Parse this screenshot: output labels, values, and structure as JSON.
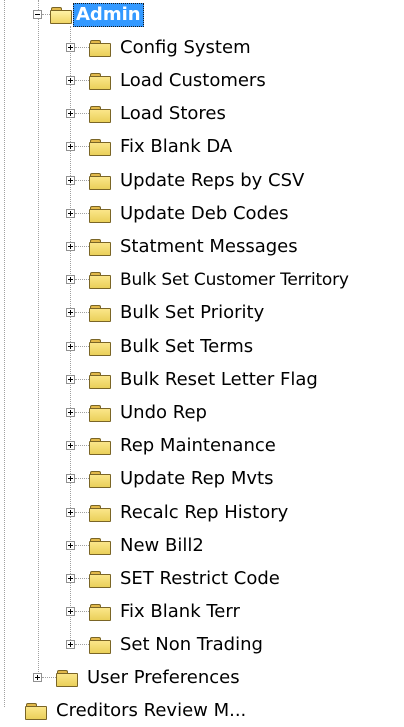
{
  "tree": {
    "root": {
      "label": "Admin",
      "expanded": true,
      "selected": true,
      "icon": "folder-open-icon",
      "children": [
        {
          "label": "Config System",
          "icon": "folder-icon",
          "expander": "plus"
        },
        {
          "label": "Load Customers",
          "icon": "folder-icon",
          "expander": "plus"
        },
        {
          "label": "Load Stores",
          "icon": "folder-icon",
          "expander": "plus"
        },
        {
          "label": "Fix Blank DA",
          "icon": "folder-icon",
          "expander": "plus"
        },
        {
          "label": "Update Reps by CSV",
          "icon": "folder-icon",
          "expander": "plus"
        },
        {
          "label": "Update Deb Codes",
          "icon": "folder-icon",
          "expander": "plus"
        },
        {
          "label": "Statment Messages",
          "icon": "folder-icon",
          "expander": "plus"
        },
        {
          "label": "Bulk Set Customer Territory",
          "icon": "folder-icon",
          "expander": "plus"
        },
        {
          "label": "Bulk Set Priority",
          "icon": "folder-icon",
          "expander": "plus"
        },
        {
          "label": "Bulk Set Terms",
          "icon": "folder-icon",
          "expander": "plus"
        },
        {
          "label": "Bulk Reset Letter Flag",
          "icon": "folder-icon",
          "expander": "plus"
        },
        {
          "label": "Undo Rep",
          "icon": "folder-icon",
          "expander": "plus"
        },
        {
          "label": "Rep Maintenance",
          "icon": "folder-icon",
          "expander": "plus"
        },
        {
          "label": "Update Rep Mvts",
          "icon": "folder-icon",
          "expander": "plus"
        },
        {
          "label": "Recalc Rep History",
          "icon": "folder-icon",
          "expander": "plus"
        },
        {
          "label": "New Bill2",
          "icon": "folder-icon",
          "expander": "plus"
        },
        {
          "label": "SET Restrict Code",
          "icon": "folder-icon",
          "expander": "plus"
        },
        {
          "label": "Fix Blank Terr",
          "icon": "folder-icon",
          "expander": "plus"
        },
        {
          "label": "Set Non Trading",
          "icon": "folder-icon",
          "expander": "plus"
        }
      ]
    },
    "siblings": [
      {
        "label": "User Preferences",
        "icon": "folder-icon",
        "expander": "plus"
      }
    ],
    "partial_next": {
      "label": "Creditors Review M...",
      "icon": "folder-icon"
    }
  },
  "colors": {
    "selection_bg": "#3399ff",
    "selection_text": "#ffffff",
    "folder_fill": "#f4da6a",
    "guide_line": "#a0a0a0"
  }
}
